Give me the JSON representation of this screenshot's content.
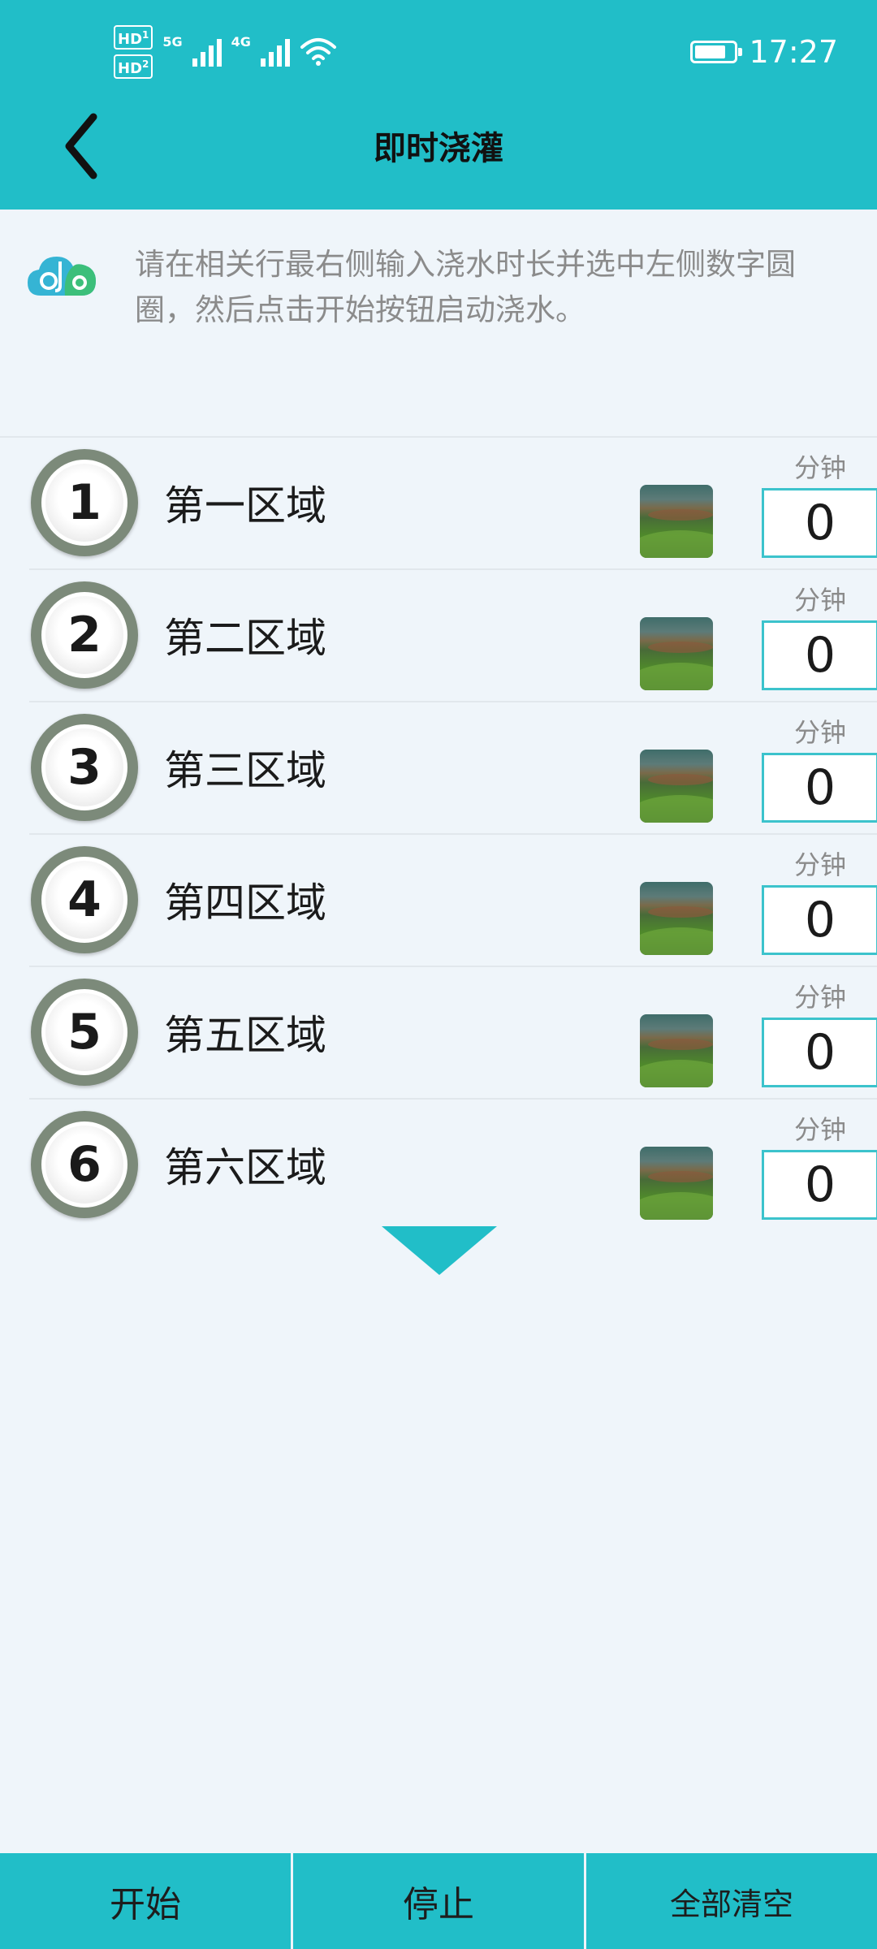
{
  "status_bar": {
    "hd1": "HD",
    "hd1_sub": "1",
    "hd2": "HD",
    "hd2_sub": "2",
    "net1": "5G",
    "net2": "4G",
    "battery_level": 0.8,
    "time": "17:27"
  },
  "header": {
    "title": "即时浇灌",
    "back_icon": "chevron-left-icon"
  },
  "info": {
    "logo_icon": "cloud-logo-icon",
    "text": "请在相关行最右侧输入浇水时长并选中左侧数字圆圈，然后点击开始按钮启动浇水。"
  },
  "zones": [
    {
      "number": "1",
      "name": "第一区域",
      "unit": "分钟",
      "minutes": "0"
    },
    {
      "number": "2",
      "name": "第二区域",
      "unit": "分钟",
      "minutes": "0"
    },
    {
      "number": "3",
      "name": "第三区域",
      "unit": "分钟",
      "minutes": "0"
    },
    {
      "number": "4",
      "name": "第四区域",
      "unit": "分钟",
      "minutes": "0"
    },
    {
      "number": "5",
      "name": "第五区域",
      "unit": "分钟",
      "minutes": "0"
    },
    {
      "number": "6",
      "name": "第六区域",
      "unit": "分钟",
      "minutes": "0"
    }
  ],
  "more_icon": "triangle-down-icon",
  "bottom_bar": {
    "start": "开始",
    "stop": "停止",
    "clear_all": "全部清空"
  },
  "colors": {
    "accent": "#21bec8",
    "background": "#eff5fa",
    "input_border": "#3cc3cc",
    "zone_ring": "#7c8a7a"
  }
}
